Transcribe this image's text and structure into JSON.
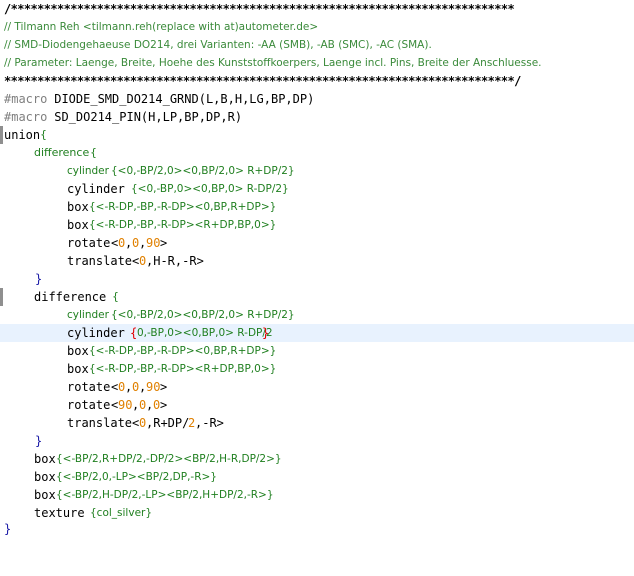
{
  "lines": [
    {
      "text": "/****************************************************************************"
    },
    {
      "text": "// Tilmann Reh <tilmann.reh(replace with at)autometer.de>"
    },
    {
      "text": "// SMD-Diodengehaeuse DO214, drei Varianten: -AA (SMB), -AB (SMC), -AC (SMA)."
    },
    {
      "text": "// Parameter: Laenge, Breite, Hoehe des Kunststoffkoerpers, Laenge incl. Pins, Breite der Anschluesse."
    },
    {
      "text": "*****************************************************************************/"
    },
    {
      "dir": "#macro",
      "rest": " DIODE_SMD_DO214_GRND(L,B,H,LG,BP,DP)"
    },
    {
      "dir": "#macro",
      "rest": " SD_DO214_PIN(H,LP,BP,DP,R)"
    },
    {
      "kw": "union",
      "brace": "{"
    },
    {
      "kw": "difference",
      "brace": "{"
    },
    {
      "kw": "cylinder",
      "args": "{<0,-BP/2,0><0,BP/2,0> R+DP/2}"
    },
    {
      "kw": "cylinder",
      "args": "{<0,-BP,0><0,BP,0> R-DP/2}"
    },
    {
      "kw": "box",
      "args": "{<-R-DP,-BP,-R-DP><0,BP,R+DP>}"
    },
    {
      "kw": "box",
      "args": "{<-R-DP,-BP,-R-DP><R+DP,BP,0>}"
    },
    {
      "kw": "rotate",
      "a": "<",
      "n1": "0",
      "c1": ",",
      "n2": "0",
      "c2": ",",
      "n3": "90",
      "z": ">"
    },
    {
      "kw": "translate",
      "a": "<",
      "n1": "0",
      "rest": ",H-R,-R>"
    },
    {
      "brace": "}"
    },
    {
      "kw": "difference",
      "brace": "{"
    },
    {
      "kw": "cylinder",
      "args": "{<0,-BP/2,0><0,BP/2,0> R+DP/2}"
    },
    {
      "kw": "cylinder",
      "open": "{",
      "args": "0,-BP,0><0,BP,0> R-DP/2",
      "close": "}"
    },
    {
      "kw": "box",
      "args": "{<-R-DP,-BP,-R-DP><0,BP,R+DP>}"
    },
    {
      "kw": "box",
      "args": "{<-R-DP,-BP,-R-DP><R+DP,BP,0>}"
    },
    {
      "kw": "rotate",
      "a": "<",
      "n1": "0",
      "c1": ",",
      "n2": "0",
      "c2": ",",
      "n3": "90",
      "z": ">"
    },
    {
      "kw": "rotate",
      "a": "<",
      "n1": "90",
      "c1": ",",
      "n2": "0",
      "c2": ",",
      "n3": "0",
      "z": ">"
    },
    {
      "kw": "translate",
      "a": "<",
      "n1": "0",
      "rest1": ",R+DP/",
      "n2": "2",
      "rest2": ",-R>"
    },
    {
      "brace": "}"
    },
    {
      "kw": "box",
      "args": "{<-BP/2,R+DP/2,-DP/2><BP/2,H-R,DP/2>}"
    },
    {
      "kw": "box",
      "args": "{<-BP/2,0,-LP><BP/2,DP,-R>}"
    },
    {
      "kw": "box",
      "args": "{<-BP/2,H-DP/2,-LP><BP/2,H+DP/2,-R>}"
    },
    {
      "kw": "texture",
      "args": "{col_silver}"
    },
    {
      "brace": "}"
    }
  ]
}
